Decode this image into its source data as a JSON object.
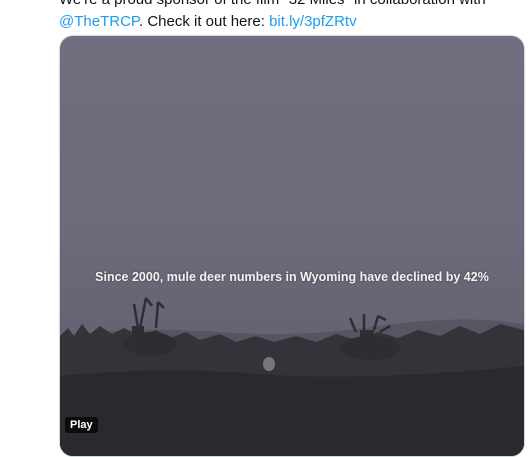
{
  "tweet": {
    "line1": "We're a proud sponsor of the film \"32 Miles\" in collaboration with",
    "mention": "@TheTRCP",
    "line2_mid": ". Check it out here:  ",
    "link": "bit.ly/3pfZRtv"
  },
  "video": {
    "caption": "Since 2000, mule deer numbers in Wyoming have declined by 42%",
    "play_label": "Play"
  },
  "colors": {
    "link": "#1d9bf0",
    "text": "#0f1419"
  }
}
